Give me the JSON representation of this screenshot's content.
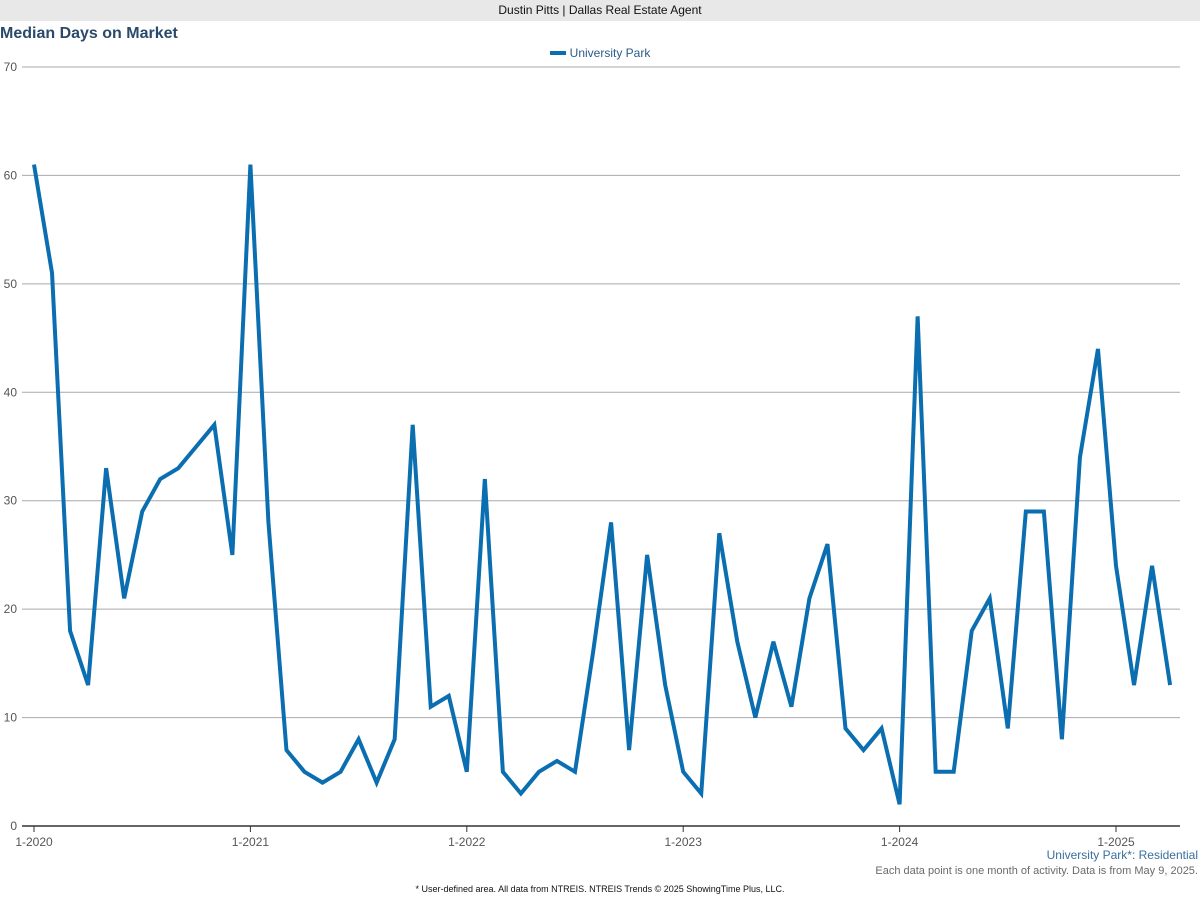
{
  "header": {
    "text": "Dustin Pitts | Dallas Real Estate Agent"
  },
  "chart_data": {
    "type": "line",
    "title": "Median Days on Market",
    "xlabel": "",
    "ylabel": "",
    "ylim": [
      0,
      70
    ],
    "yticks": [
      0,
      10,
      20,
      30,
      40,
      50,
      60,
      70
    ],
    "xlim": [
      "1-2020",
      "4-2025"
    ],
    "xticks": [
      "1-2020",
      "1-2021",
      "1-2022",
      "1-2023",
      "1-2024",
      "1-2025"
    ],
    "grid": true,
    "legend": "top-center",
    "series": [
      {
        "name": "University Park",
        "color": "#0a6eb0",
        "x": [
          "1-2020",
          "2-2020",
          "3-2020",
          "4-2020",
          "5-2020",
          "6-2020",
          "7-2020",
          "8-2020",
          "9-2020",
          "10-2020",
          "11-2020",
          "12-2020",
          "1-2021",
          "2-2021",
          "3-2021",
          "4-2021",
          "5-2021",
          "6-2021",
          "7-2021",
          "8-2021",
          "9-2021",
          "10-2021",
          "11-2021",
          "12-2021",
          "1-2022",
          "2-2022",
          "3-2022",
          "4-2022",
          "5-2022",
          "6-2022",
          "7-2022",
          "8-2022",
          "9-2022",
          "10-2022",
          "11-2022",
          "12-2022",
          "1-2023",
          "2-2023",
          "3-2023",
          "4-2023",
          "5-2023",
          "6-2023",
          "7-2023",
          "8-2023",
          "9-2023",
          "10-2023",
          "11-2023",
          "12-2023",
          "1-2024",
          "2-2024",
          "3-2024",
          "4-2024",
          "5-2024",
          "6-2024",
          "7-2024",
          "8-2024",
          "9-2024",
          "10-2024",
          "11-2024",
          "12-2024",
          "1-2025",
          "2-2025",
          "3-2025",
          "4-2025"
        ],
        "values": [
          61,
          51,
          18,
          13,
          33,
          21,
          29,
          32,
          33,
          35,
          37,
          25,
          61,
          28,
          7,
          5,
          4,
          5,
          8,
          4,
          8,
          37,
          11,
          12,
          5,
          32,
          5,
          3,
          5,
          6,
          5,
          16,
          28,
          7,
          25,
          13,
          5,
          3,
          27,
          17,
          10,
          17,
          11,
          21,
          26,
          9,
          7,
          9,
          2,
          47,
          5,
          5,
          18,
          21,
          9,
          29,
          29,
          8,
          34,
          44,
          24,
          13,
          24,
          13
        ]
      }
    ]
  },
  "notes": {
    "subtitle": "University Park*: Residential",
    "data_note": "Each data point is one month of activity. Data is from May 9, 2025.",
    "footer": "* User-defined area. All data from NTREIS. NTREIS Trends © 2025 ShowingTime Plus, LLC."
  }
}
